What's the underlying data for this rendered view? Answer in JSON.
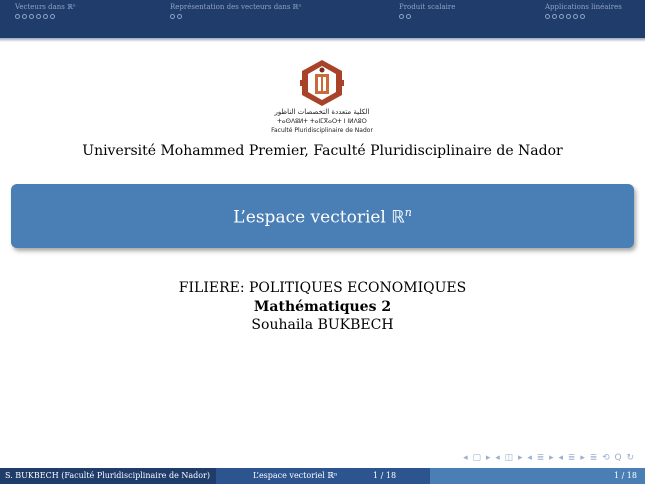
{
  "nav": {
    "sections": [
      {
        "label": "Vecteurs dans ℝⁿ",
        "dots": 6
      },
      {
        "label": "Représentation des vecteurs dans ℝⁿ",
        "dots": 2
      },
      {
        "label": "Produit scalaire",
        "dots": 2
      },
      {
        "label": "Applications linéaires",
        "dots": 6
      }
    ]
  },
  "logo": {
    "arabic_text": "الكلية متعددة التخصصات الناظور",
    "tifinagh_text": "ⵜⴰⵙⴷⵓⵍⵜ ⵜⴰⵏⵎⴳⴰⵔⵜ ⵏ ⵏⵍⴷⵓⵔ",
    "french_text": "Faculté Pluridisciplinaire de Nador"
  },
  "institute": "Université Mohammed Premier, Faculté Pluridisciplinaire de Nador",
  "title": {
    "text": "L’espace vectoriel ",
    "symbol": "ℝ",
    "exponent": "n"
  },
  "filiere": "FILIERE: POLITIQUES ECONOMIQUES",
  "subject": "Mathématiques 2",
  "author": "Souhaila BUKBECH",
  "nav_symbols": "◂ ▢ ▸ ◂ ◫ ▸ ◂ ≣ ▸ ◂ ≣ ▸ ≣ ⟲ Q ↻",
  "footer": {
    "author_affil": "S. BUKBECH  (Faculté Pluridisciplinaire de Nador)",
    "short_title": "L’espace vectoriel ℝⁿ",
    "center_page": "1 / 18",
    "right_page": "1 / 18"
  },
  "colors": {
    "nav_bg": "#1f3c6b",
    "title_box": "#4a7fb5",
    "footer_mid": "#2c5590"
  }
}
